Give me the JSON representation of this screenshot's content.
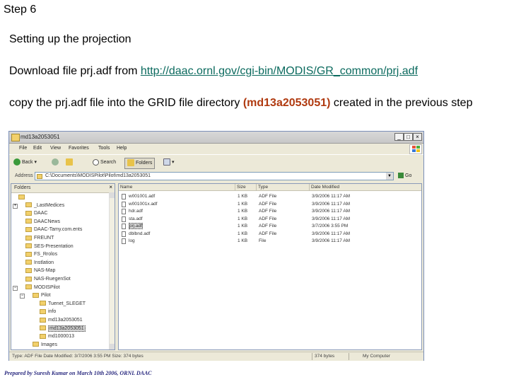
{
  "slide": {
    "step": "Step 6",
    "heading": "Setting up the projection",
    "download_prefix": "Download file prj.adf from ",
    "download_link": "http://daac.ornl.gov/cgi-bin/MODIS/GR_common/prj.adf",
    "copy_prefix": "copy the prj.adf file into the GRID file directory ",
    "copy_highlight": "(md13a2053051)",
    "copy_suffix": " created in the previous step",
    "footer": "Prepared by Suresh Kumar on March 10th 2006, ORNL DAAC",
    "colors": {
      "link": "#0b6a5e",
      "highlight": "#b03a10"
    }
  },
  "window": {
    "title": "md13a2053051",
    "controls": {
      "minimize": "_",
      "maximize": "□",
      "close": "×"
    },
    "menu": [
      "File",
      "Edit",
      "View",
      "Favorites",
      "Tools",
      "Help"
    ],
    "toolbar": {
      "back": "Back",
      "search": "Search",
      "folders": "Folders"
    },
    "address": {
      "label": "Address",
      "path": "C:\\Documents\\MODISPilot\\Pilot\\md13a2053051",
      "go": "Go"
    },
    "folders_pane": {
      "title": "Folders",
      "close": "×",
      "items": [
        {
          "label": "",
          "indent": 0
        },
        {
          "label": "_LastMedices",
          "indent": 1
        },
        {
          "label": "DAAC",
          "indent": 1
        },
        {
          "label": "DAACNews",
          "indent": 1
        },
        {
          "label": "DAAC-Tamy.com.ents",
          "indent": 1
        },
        {
          "label": "FREUNT",
          "indent": 1
        },
        {
          "label": "SES-Presentation",
          "indent": 1
        },
        {
          "label": "FS_Rrolos",
          "indent": 1
        },
        {
          "label": "Instlation",
          "indent": 1
        },
        {
          "label": "NAS-Map",
          "indent": 1
        },
        {
          "label": "NAS-RuegenSot",
          "indent": 1
        },
        {
          "label": "MODISPilot",
          "indent": 1
        },
        {
          "label": "Pilot",
          "indent": 2
        },
        {
          "label": "Tuenet_SLEGET",
          "indent": 3
        },
        {
          "label": "info",
          "indent": 3
        },
        {
          "label": "md13a2053051",
          "indent": 3
        },
        {
          "label": "md13a2053051",
          "indent": 3,
          "selected": true
        },
        {
          "label": "md1000013",
          "indent": 3
        },
        {
          "label": "Images",
          "indent": 2
        }
      ]
    },
    "files": {
      "columns": [
        "Name",
        "Size",
        "Type",
        "Date Modified"
      ],
      "rows": [
        {
          "name": "w001001.adf",
          "size": "1 KB",
          "type": "ADF File",
          "date": "3/9/2006 11:17 AM"
        },
        {
          "name": "w001001x.adf",
          "size": "1 KB",
          "type": "ADF File",
          "date": "3/9/2006 11:17 AM"
        },
        {
          "name": "hdr.adf",
          "size": "1 KB",
          "type": "ADF File",
          "date": "3/9/2006 11:17 AM"
        },
        {
          "name": "sta.adf",
          "size": "1 KB",
          "type": "ADF File",
          "date": "3/9/2006 11:17 AM"
        },
        {
          "name": "prj.adf",
          "size": "1 KB",
          "type": "ADF File",
          "date": "3/7/2006 3:55 PM",
          "selected": true
        },
        {
          "name": "dblbnd.adf",
          "size": "1 KB",
          "type": "ADF File",
          "date": "3/9/2006 11:17 AM"
        },
        {
          "name": "log",
          "size": "1 KB",
          "type": "File",
          "date": "3/9/2006 11:17 AM"
        }
      ]
    },
    "status": {
      "left": "Type: ADF File Date Modified: 3/7/2006 3:55 PM Size: 374 bytes",
      "size": "374 bytes",
      "location": "My Computer"
    }
  }
}
